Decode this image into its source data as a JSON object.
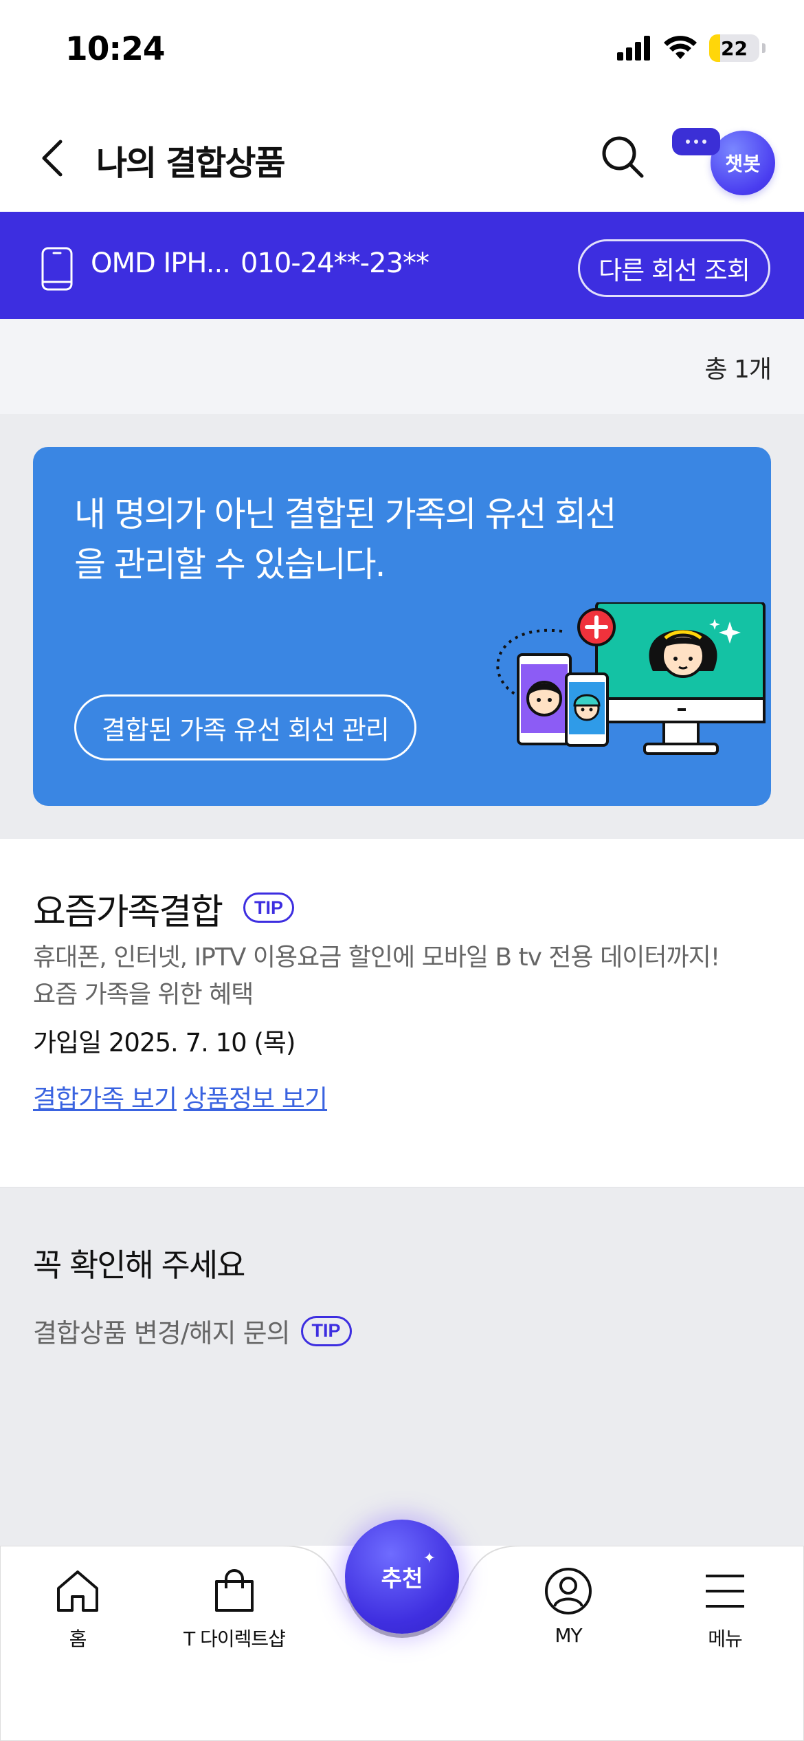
{
  "status_bar": {
    "time": "10:24",
    "battery": "22",
    "battery_level": 0.22
  },
  "header": {
    "title": "나의 결합상품",
    "chatbot_label": "챗봇"
  },
  "line": {
    "device": "OMD IPH...",
    "number": "010-24**-23**",
    "other_line_button": "다른 회선 조회"
  },
  "summary": {
    "total": "총 1개"
  },
  "banner": {
    "text": "내 명의가 아닌 결합된 가족의 유선 회선을 관리할 수 있습니다.",
    "button": "결합된 가족 유선 회선 관리"
  },
  "product": {
    "title": "요즘가족결합",
    "tip": "TIP",
    "description": "휴대폰, 인터넷, IPTV 이용요금 할인에 모바일 B tv 전용 데이터까지! 요즘 가족을 위한 혜택",
    "join_date": "가입일 2025. 7. 10 (목)",
    "links": [
      "결합가족 보기",
      "상품정보 보기"
    ]
  },
  "notice": {
    "title": "꼭 확인해 주세요",
    "item": "결합상품 변경/해지 문의",
    "tip": "TIP"
  },
  "bottom_nav": {
    "items": [
      "홈",
      "T 다이렉트샵",
      "MY",
      "메뉴"
    ],
    "center": "추천"
  },
  "colors": {
    "brand": "#3d2ee0",
    "banner": "#3a86e3",
    "link": "#3a63e0",
    "battery": "#ffd60a"
  }
}
